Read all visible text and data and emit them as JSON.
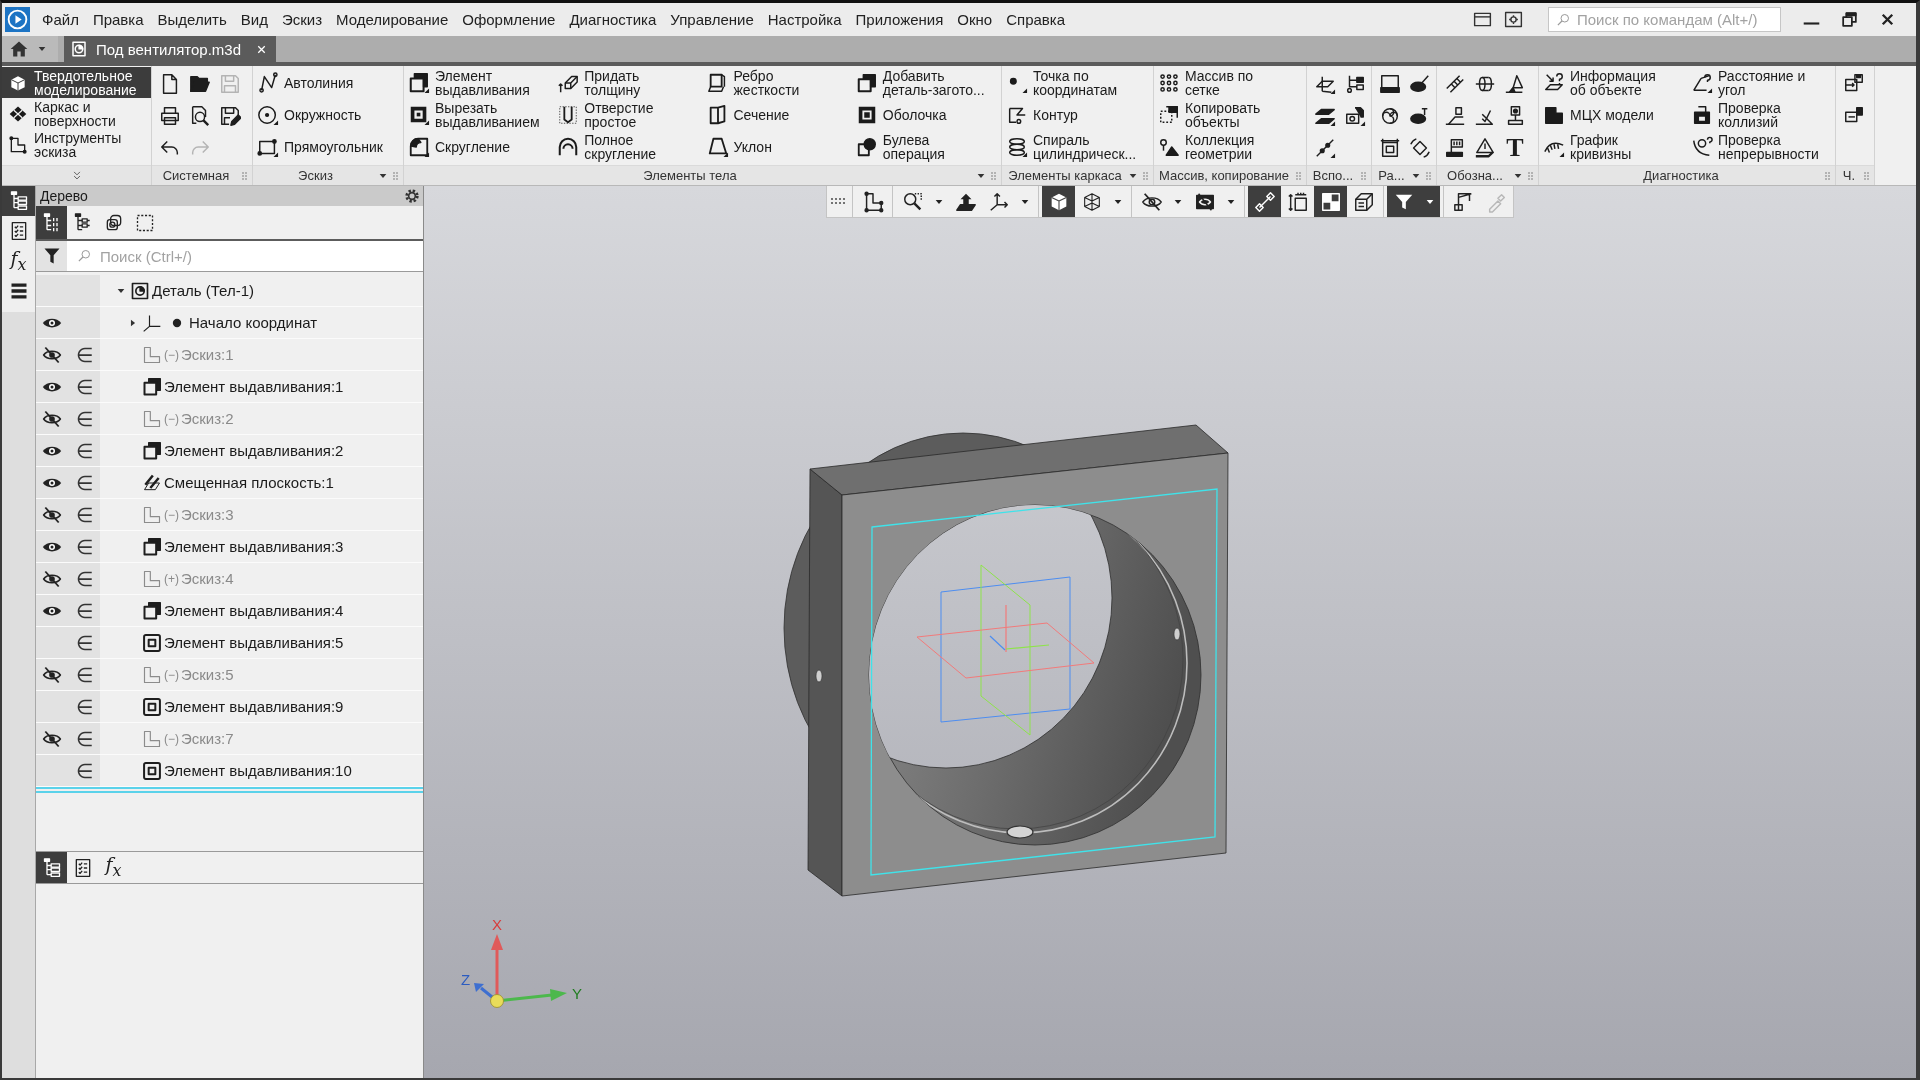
{
  "title_bar": {
    "menu": [
      "Файл",
      "Правка",
      "Выделить",
      "Вид",
      "Эскиз",
      "Моделирование",
      "Оформление",
      "Диагностика",
      "Управление",
      "Настройка",
      "Приложения",
      "Окно",
      "Справка"
    ],
    "command_search": {
      "placeholder": "Поиск по командам (Alt+/)"
    }
  },
  "document_tabs": [
    {
      "label": "Под вентилятор.m3d",
      "selected": true
    }
  ],
  "ribbon": {
    "modes": [
      {
        "kind": "solid",
        "label": "Твердотельное\nмоделирование",
        "selected": true
      },
      {
        "kind": "surface",
        "label": "Каркас и\nповерхности",
        "selected": false
      },
      {
        "kind": "sketch",
        "label": "Инструменты\nэскиза",
        "selected": false
      }
    ],
    "groups": [
      {
        "title": "Системная",
        "kind": "icons",
        "dropdown": false,
        "rows": [
          [
            {
              "kind": "new",
              "disabled": false
            },
            {
              "kind": "open",
              "disabled": false
            },
            {
              "kind": "save",
              "disabled": true
            }
          ],
          [
            {
              "kind": "print",
              "disabled": false
            },
            {
              "kind": "preview",
              "disabled": false
            },
            {
              "kind": "saveas",
              "disabled": false
            }
          ],
          [
            {
              "kind": "undo",
              "disabled": false
            },
            {
              "kind": "redo",
              "disabled": true
            }
          ]
        ]
      },
      {
        "title": "Эскиз",
        "kind": "commands",
        "dropdown": true,
        "columns": [
          [
            {
              "kind": "autoline",
              "label": "Автолиния"
            },
            {
              "kind": "circle",
              "label": "Окружность"
            },
            {
              "kind": "rectangle",
              "label": "Прямоугольник"
            }
          ]
        ]
      },
      {
        "title": "Элементы тела",
        "kind": "commands",
        "dropdown": true,
        "columns": [
          [
            {
              "kind": "extrude",
              "label": "Элемент\nвыдавливания"
            },
            {
              "kind": "cut",
              "label": "Вырезать\nвыдавливанием"
            },
            {
              "kind": "fillet",
              "label": "Скругление"
            }
          ],
          [
            {
              "kind": "thicken",
              "label": "Придать\nтолщину"
            },
            {
              "kind": "hole",
              "label": "Отверстие\nпростое"
            },
            {
              "kind": "fullround",
              "label": "Полное\nскругление"
            }
          ],
          [
            {
              "kind": "rib",
              "label": "Ребро\nжесткости"
            },
            {
              "kind": "section",
              "label": "Сечение"
            },
            {
              "kind": "draft",
              "label": "Уклон"
            }
          ],
          [
            {
              "kind": "addpart",
              "label": "Добавить\nдеталь-загото..."
            },
            {
              "kind": "shell",
              "label": "Оболочка"
            },
            {
              "kind": "boolean",
              "label": "Булева\nоперация"
            }
          ]
        ]
      },
      {
        "title": "Элементы каркаса",
        "kind": "commands",
        "dropdown": true,
        "columns": [
          [
            {
              "kind": "point",
              "label": "Точка по\nкоординатам"
            },
            {
              "kind": "contour",
              "label": "Контур"
            },
            {
              "kind": "helix",
              "label": "Спираль\nцилиндрическ..."
            }
          ]
        ]
      },
      {
        "title": "Массив, копирование",
        "kind": "commands",
        "dropdown": false,
        "columns": [
          [
            {
              "kind": "pattern",
              "label": "Массив по\nсетке"
            },
            {
              "kind": "copy",
              "label": "Копировать\nобъекты"
            },
            {
              "kind": "collection",
              "label": "Коллекция\nгеометрии"
            }
          ]
        ]
      },
      {
        "title": "Вспо...",
        "kind": "icons",
        "dropdown": false,
        "rows": [
          [
            {
              "kind": "planeaxis"
            },
            {
              "kind": "branch"
            }
          ],
          [
            {
              "kind": "planes"
            },
            {
              "kind": "camera"
            }
          ],
          [
            {
              "kind": "linepoints"
            }
          ]
        ]
      },
      {
        "title": "Ра...",
        "kind": "icons",
        "dropdown": true,
        "rows": [
          [
            {
              "kind": "screen"
            },
            {
              "kind": "discpen"
            }
          ],
          [
            {
              "kind": "flower"
            },
            {
              "kind": "discpin"
            }
          ],
          [
            {
              "kind": "framecube"
            },
            {
              "kind": "rotate"
            }
          ]
        ]
      },
      {
        "title": "Обозна...",
        "kind": "icons",
        "dropdown": true,
        "rows": [
          [
            {
              "kind": "spring"
            },
            {
              "kind": "cylinder"
            },
            {
              "kind": "roughness"
            }
          ],
          [
            {
              "kind": "base"
            },
            {
              "kind": "tick"
            },
            {
              "kind": "leader"
            }
          ],
          [
            {
              "kind": "flag"
            },
            {
              "kind": "triangle"
            },
            {
              "kind": "text",
              "label": "T"
            }
          ]
        ]
      },
      {
        "title": "Диагностика",
        "kind": "commands",
        "dropdown": false,
        "columns": [
          [
            {
              "kind": "info",
              "label": "Информация\nоб объекте"
            },
            {
              "kind": "mass",
              "label": "МЦХ модели"
            },
            {
              "kind": "curvature",
              "label": "График\nкривизны"
            }
          ],
          [
            {
              "kind": "distance",
              "label": "Расстояние и\nугол"
            },
            {
              "kind": "collision",
              "label": "Проверка\nколлизий"
            },
            {
              "kind": "continuity",
              "label": "Проверка\nнепрерывности"
            }
          ]
        ]
      },
      {
        "title": "Ч.",
        "kind": "icons",
        "dropdown": false,
        "rows": [
          [
            {
              "kind": "tablein"
            }
          ],
          [
            {
              "kind": "tableout"
            }
          ]
        ]
      }
    ]
  },
  "side_tabs": [
    {
      "kind": "tree",
      "selected": true
    },
    {
      "kind": "properties",
      "selected": false
    },
    {
      "kind": "variables",
      "label": "f$_{x}$",
      "selected": false
    },
    {
      "kind": "list",
      "selected": false
    }
  ],
  "tree_panel": {
    "title": "Дерево",
    "tools": [
      {
        "kind": "numbered",
        "selected": true
      },
      {
        "kind": "structure",
        "selected": false
      },
      {
        "kind": "bodies",
        "selected": false
      },
      {
        "kind": "frame",
        "selected": false
      }
    ],
    "search": {
      "placeholder": "Поиск (Ctrl+/)"
    },
    "items": [
      {
        "kind": "part",
        "label": "Деталь (Тел-1)",
        "expanded": true,
        "children": [
          {
            "kind": "origin",
            "label": "Начало координат",
            "hidden": false,
            "expanded": false
          },
          {
            "kind": "sketch",
            "status": "(−)",
            "label": "Эскиз:1",
            "hidden": true,
            "marker": "∈"
          },
          {
            "kind": "boss",
            "label": "Элемент выдавливания:1",
            "hidden": false,
            "marker": "∈"
          },
          {
            "kind": "sketch",
            "status": "(−)",
            "label": "Эскиз:2",
            "hidden": true,
            "marker": "∈"
          },
          {
            "kind": "boss",
            "label": "Элемент выдавливания:2",
            "hidden": false,
            "marker": "∈"
          },
          {
            "kind": "plane",
            "label": "Смещенная плоскость:1",
            "hidden": false,
            "marker": "∈"
          },
          {
            "kind": "sketch",
            "status": "(−)",
            "label": "Эскиз:3",
            "hidden": true,
            "marker": "∈"
          },
          {
            "kind": "boss",
            "label": "Элемент выдавливания:3",
            "hidden": false,
            "marker": "∈"
          },
          {
            "kind": "sketch",
            "status": "(+)",
            "label": "Эскиз:4",
            "hidden": true,
            "marker": "∈"
          },
          {
            "kind": "boss",
            "label": "Элемент выдавливания:4",
            "hidden": false,
            "marker": "∈"
          },
          {
            "kind": "cut",
            "label": "Элемент выдавливания:5",
            "marker": "∈"
          },
          {
            "kind": "sketch",
            "status": "(−)",
            "label": "Эскиз:5",
            "hidden": true,
            "marker": "∈"
          },
          {
            "kind": "cut",
            "label": "Элемент выдавливания:9",
            "marker": "∈"
          },
          {
            "kind": "sketch",
            "status": "(−)",
            "label": "Эскиз:7",
            "hidden": true,
            "marker": "∈"
          },
          {
            "kind": "cut",
            "label": "Элемент выдавливания:10",
            "marker": "∈"
          }
        ]
      }
    ],
    "bottom_tabs": [
      {
        "kind": "tree",
        "selected": true
      },
      {
        "kind": "properties",
        "selected": false
      },
      {
        "kind": "variables",
        "label": "f$_{x}$",
        "selected": false
      }
    ]
  },
  "viewport": {
    "view_toolbar": {
      "groups": [
        [
          {
            "kind": "grip"
          }
        ],
        [
          {
            "kind": "sketch",
            "selected": false
          }
        ],
        [
          {
            "kind": "zoom",
            "selected": false
          },
          {
            "kind": "caret",
            "selected": false
          },
          {
            "kind": "normal",
            "selected": false
          },
          {
            "kind": "axes",
            "selected": false
          },
          {
            "kind": "caret",
            "selected": false
          }
        ],
        [
          {
            "kind": "shaded",
            "selected": true
          },
          {
            "kind": "wireframe",
            "selected": false
          },
          {
            "kind": "caret",
            "selected": false
          }
        ],
        [
          {
            "kind": "hide",
            "selected": false
          },
          {
            "kind": "caret",
            "selected": false
          },
          {
            "kind": "hidden",
            "selected": false
          },
          {
            "kind": "caret",
            "selected": false
          }
        ],
        [
          {
            "kind": "nodes",
            "selected": true
          },
          {
            "kind": "measure",
            "selected": false
          },
          {
            "kind": "cubes",
            "selected": true
          },
          {
            "kind": "layers",
            "selected": false
          }
        ],
        [
          {
            "kind": "filter",
            "selected": true
          },
          {
            "kind": "caret",
            "selected": true
          }
        ],
        [
          {
            "kind": "crane",
            "selected": false,
            "disabled": false
          },
          {
            "kind": "pipette",
            "selected": false,
            "disabled": true
          }
        ]
      ]
    },
    "axis_triad": {
      "x": "X",
      "y": "Y",
      "z": "Z"
    }
  }
}
